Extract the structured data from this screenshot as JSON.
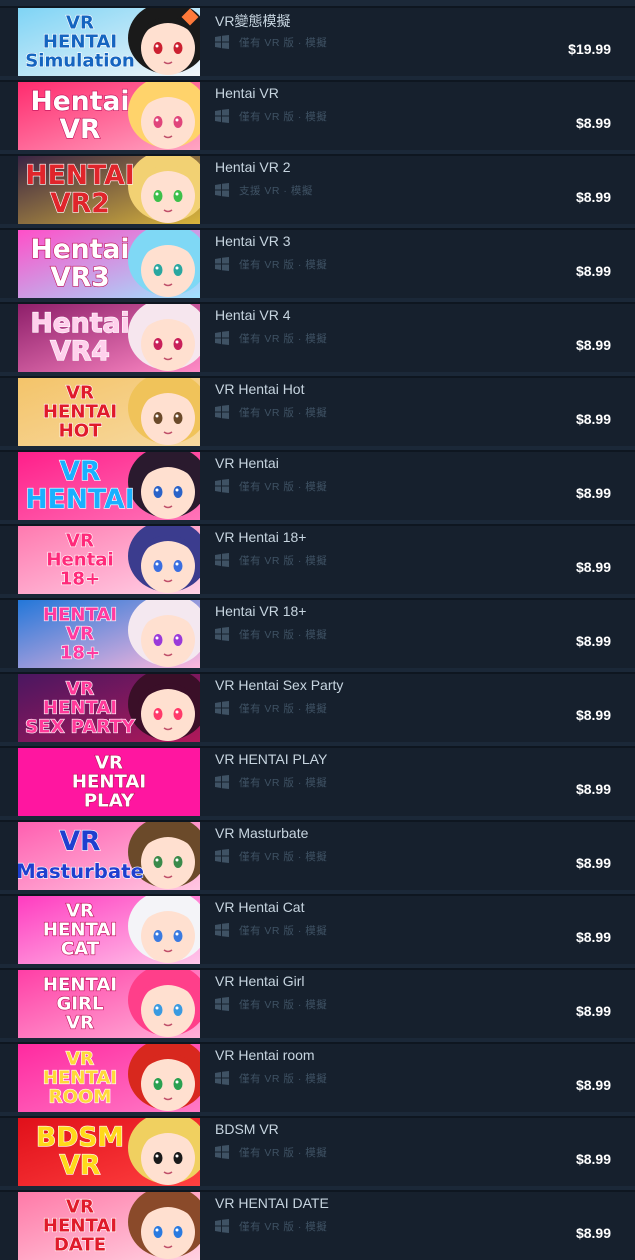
{
  "platform_icon": "windows-icon",
  "items": [
    {
      "title": "VR變態模擬",
      "vr_support": "僅有 VR 版 · 模擬",
      "price": "$19.99",
      "logo_lines": [
        "VR",
        "HENTAI",
        "Simulation"
      ],
      "bg": [
        "#7fd4f5",
        "#f2f6fa"
      ],
      "text_color": "#1565c0",
      "char_hair": "#1a1a1a",
      "char_eye": "#cc2030",
      "icon": "kite-gradient"
    },
    {
      "title": "Hentai VR",
      "vr_support": "僅有 VR 版 · 模擬",
      "price": "$8.99",
      "logo_lines": [
        "Hentai",
        "VR"
      ],
      "bg": [
        "#ff2b6e",
        "#ffa5c3"
      ],
      "text_color": "#ffffff",
      "char_hair": "#ffd36b",
      "char_eye": "#e0457b"
    },
    {
      "title": "Hentai VR 2",
      "vr_support": "支援 VR · 模擬",
      "price": "$8.99",
      "logo_lines": [
        "HENTAI",
        "VR2"
      ],
      "bg": [
        "#3a2445",
        "#d8b43c"
      ],
      "text_color": "#e0252b",
      "char_hair": "#f2d173",
      "char_eye": "#3cbf4a"
    },
    {
      "title": "Hentai VR 3",
      "vr_support": "僅有 VR 版 · 模擬",
      "price": "$8.99",
      "logo_lines": [
        "Hentai",
        "VR3"
      ],
      "bg": [
        "#ff4fc8",
        "#9fe3ff"
      ],
      "text_color": "#ffffff",
      "char_hair": "#7fd8f5",
      "char_eye": "#2aa7a0"
    },
    {
      "title": "Hentai VR 4",
      "vr_support": "僅有 VR 版 · 模擬",
      "price": "$8.99",
      "logo_lines": [
        "Hentai",
        "VR4"
      ],
      "bg": [
        "#8e1f6a",
        "#ff8ac6"
      ],
      "text_color": "#ffd0ec",
      "char_hair": "#f6e6ee",
      "char_eye": "#c8205a"
    },
    {
      "title": "VR Hentai Hot",
      "vr_support": "僅有 VR 版 · 模擬",
      "price": "$8.99",
      "logo_lines": [
        "VR",
        "HENTAI",
        "HOT"
      ],
      "bg": [
        "#f4c46a",
        "#f7d9a0"
      ],
      "text_color": "#e01b2b",
      "char_hair": "#f0c35a",
      "char_eye": "#6b4a2a"
    },
    {
      "title": "VR Hentai",
      "vr_support": "僅有 VR 版 · 模擬",
      "price": "$8.99",
      "logo_lines": [
        "VR",
        "HENTAI"
      ],
      "bg": [
        "#ff1f8a",
        "#ff74b8"
      ],
      "text_color": "#1ab0ff",
      "char_hair": "#2a1a2e",
      "char_eye": "#2a62c8"
    },
    {
      "title": "VR Hentai 18+",
      "vr_support": "僅有 VR 版 · 模擬",
      "price": "$8.99",
      "logo_lines": [
        "VR",
        "Hentai",
        "18+"
      ],
      "bg": [
        "#ff7ab0",
        "#ffd2e6"
      ],
      "text_color": "#ff2a7a",
      "char_hair": "#3b3c8e",
      "char_eye": "#3a6ee0"
    },
    {
      "title": "Hentai VR 18+",
      "vr_support": "僅有 VR 版 · 模擬",
      "price": "$8.99",
      "logo_lines": [
        "HENTAI",
        "VR",
        "18+"
      ],
      "bg": [
        "#2377d9",
        "#ffb8dd"
      ],
      "text_color": "#ff3aa0",
      "char_hair": "#f4e8f0",
      "char_eye": "#9a3ad9"
    },
    {
      "title": "VR Hentai Sex Party",
      "vr_support": "僅有 VR 版 · 模擬",
      "price": "$8.99",
      "logo_lines": [
        "VR",
        "HENTAI",
        "SEX PARTY"
      ],
      "bg": [
        "#4a1760",
        "#b0185a"
      ],
      "text_color": "#ff3a9a",
      "char_hair": "#3a0f28",
      "char_eye": "#ff3a6a"
    },
    {
      "title": "VR HENTAI PLAY",
      "vr_support": "僅有 VR 版 · 模擬",
      "price": "$8.99",
      "logo_lines": [
        "VR",
        "HENTAI",
        "PLAY"
      ],
      "bg": [
        "#ff16a0",
        "#ff16a0"
      ],
      "text_color": "#ffffff",
      "char_hair": "",
      "char_eye": ""
    },
    {
      "title": "VR Masturbate",
      "vr_support": "僅有 VR 版 · 模擬",
      "price": "$8.99",
      "logo_lines": [
        "VR",
        "Masturbate"
      ],
      "bg": [
        "#ff5fb0",
        "#ffc7e2"
      ],
      "text_color": "#1f3fcf",
      "char_hair": "#6b4a2a",
      "char_eye": "#3a8a4a"
    },
    {
      "title": "VR Hentai Cat",
      "vr_support": "僅有 VR 版 · 模擬",
      "price": "$8.99",
      "logo_lines": [
        "VR",
        "HENTAI",
        "CAT"
      ],
      "bg": [
        "#ff3cc0",
        "#ffc7ea"
      ],
      "text_color": "#ffffff",
      "char_hair": "#f4f4f8",
      "char_eye": "#3a7ae0"
    },
    {
      "title": "VR Hentai Girl",
      "vr_support": "僅有 VR 版 · 模擬",
      "price": "$8.99",
      "logo_lines": [
        "HENTAI",
        "GIRL",
        "VR"
      ],
      "bg": [
        "#ff3fa6",
        "#ffb0d8"
      ],
      "text_color": "#ffffff",
      "char_hair": "#ff3f8a",
      "char_eye": "#3a9ae0"
    },
    {
      "title": "VR Hentai room",
      "vr_support": "僅有 VR 版 · 模擬",
      "price": "$8.99",
      "logo_lines": [
        "VR",
        "HENTAI",
        "ROOM"
      ],
      "bg": [
        "#ff2aa0",
        "#ff7ac6"
      ],
      "text_color": "#ffd83a",
      "char_hair": "#d8281e",
      "char_eye": "#2aa050"
    },
    {
      "title": "BDSM VR",
      "vr_support": "僅有 VR 版 · 模擬",
      "price": "$8.99",
      "logo_lines": [
        "BDSM",
        "VR"
      ],
      "bg": [
        "#e0101a",
        "#ff4040"
      ],
      "text_color": "#ffd81a",
      "char_hair": "#f0d060",
      "char_eye": "#1a1a1a"
    },
    {
      "title": "VR HENTAI DATE",
      "vr_support": "僅有 VR 版 · 模擬",
      "price": "$8.99",
      "logo_lines": [
        "VR",
        "HENTAI",
        "DATE"
      ],
      "bg": [
        "#ff7aa8",
        "#ffd0e0"
      ],
      "text_color": "#e01b2b",
      "char_hair": "#8a4a2a",
      "char_eye": "#2a7ae0"
    }
  ]
}
